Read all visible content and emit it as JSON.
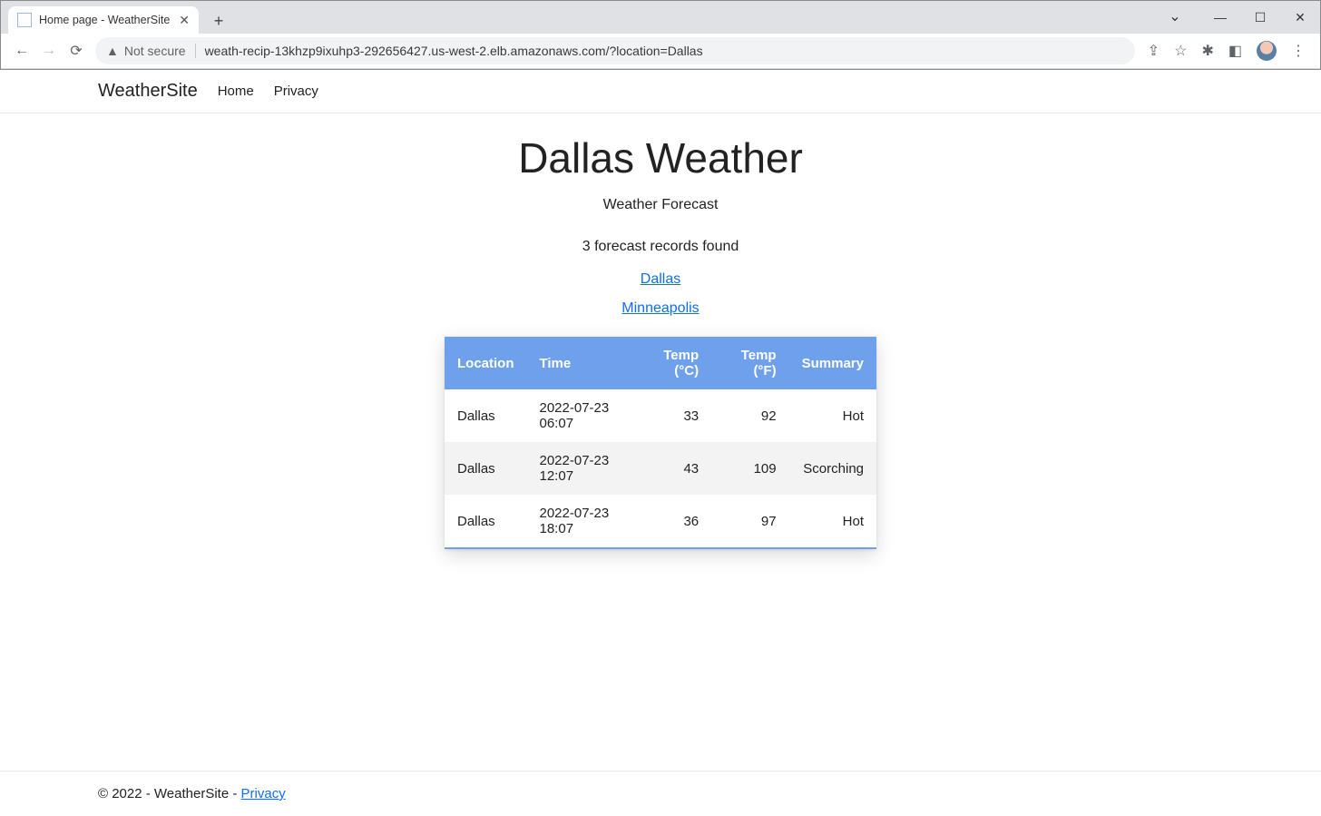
{
  "browser": {
    "tab_title": "Home page - WeatherSite",
    "not_secure": "Not secure",
    "url": "weath-recip-13khzp9ixuhp3-292656427.us-west-2.elb.amazonaws.com/?location=Dallas"
  },
  "nav": {
    "brand": "WeatherSite",
    "home": "Home",
    "privacy": "Privacy"
  },
  "page": {
    "title": "Dallas Weather",
    "subtitle": "Weather Forecast",
    "records_found": "3 forecast records found",
    "location_links": [
      "Dallas",
      "Minneapolis"
    ]
  },
  "table": {
    "headers": {
      "location": "Location",
      "time": "Time",
      "temp_c": "Temp (°C)",
      "temp_f": "Temp (°F)",
      "summary": "Summary"
    },
    "rows": [
      {
        "location": "Dallas",
        "time": "2022-07-23 06:07",
        "temp_c": "33",
        "temp_f": "92",
        "summary": "Hot"
      },
      {
        "location": "Dallas",
        "time": "2022-07-23 12:07",
        "temp_c": "43",
        "temp_f": "109",
        "summary": "Scorching"
      },
      {
        "location": "Dallas",
        "time": "2022-07-23 18:07",
        "temp_c": "36",
        "temp_f": "97",
        "summary": "Hot"
      }
    ]
  },
  "footer": {
    "copyright": "© 2022 - WeatherSite - ",
    "privacy": "Privacy"
  }
}
